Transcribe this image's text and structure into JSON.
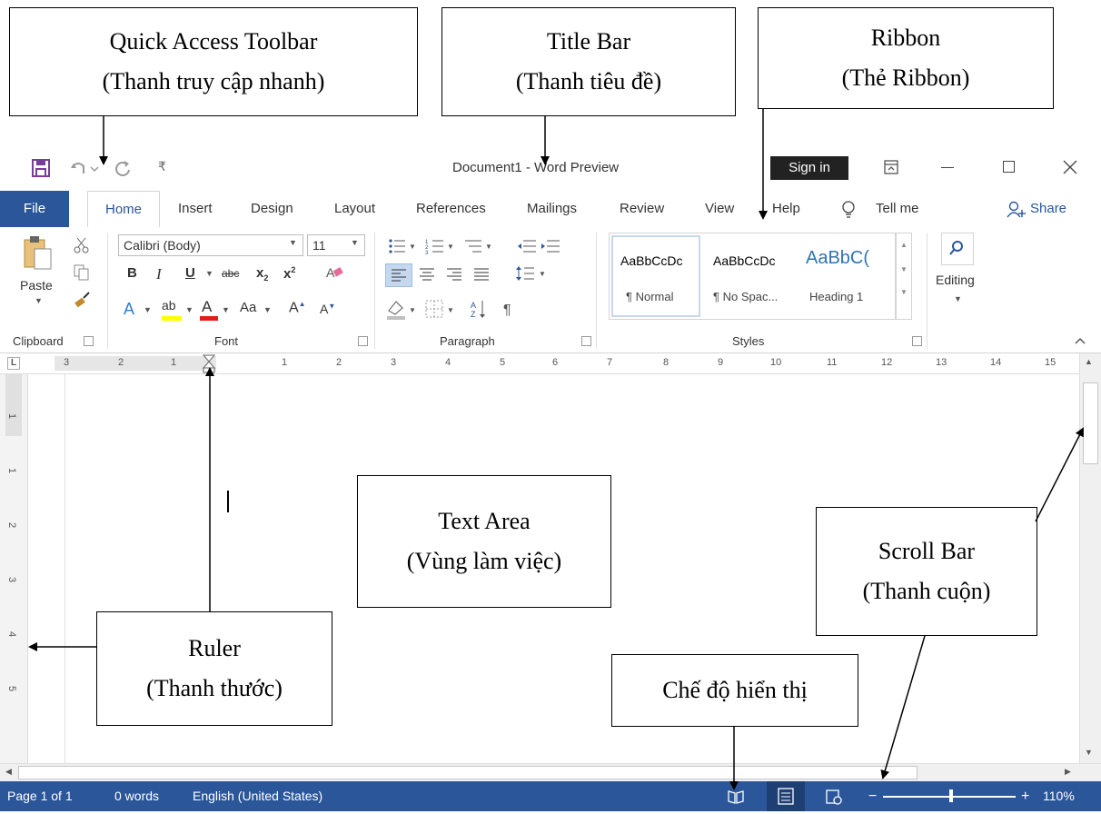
{
  "annotations": {
    "qat": {
      "line1": "Quick Access Toolbar",
      "line2": "(Thanh truy cập nhanh)"
    },
    "title_bar": {
      "line1": "Title Bar",
      "line2": "(Thanh tiêu đề)"
    },
    "ribbon": {
      "line1": "Ribbon",
      "line2": "(Thẻ Ribbon)"
    },
    "text_area": {
      "line1": "Text Area",
      "line2": "(Vùng làm việc)"
    },
    "scroll_bar": {
      "line1": "Scroll Bar",
      "line2": "(Thanh cuộn)"
    },
    "ruler": {
      "line1": "Ruler",
      "line2": "(Thanh thước)"
    },
    "view_modes": {
      "line1": "Chế độ hiển thị"
    }
  },
  "window": {
    "title": "Document1  -  Word Preview",
    "sign_in": "Sign in",
    "tabs": [
      "File",
      "Home",
      "Insert",
      "Design",
      "Layout",
      "References",
      "Mailings",
      "Review",
      "View",
      "Help"
    ],
    "tell_me": "Tell me",
    "share": "Share"
  },
  "ribbon": {
    "paste": "Paste",
    "font_name": "Calibri (Body)",
    "font_size": "11",
    "aa_label": "Aa",
    "styles": [
      {
        "preview": "AaBbCcDc",
        "name": "¶ Normal"
      },
      {
        "preview": "AaBbCcDc",
        "name": "¶ No Spac..."
      },
      {
        "preview": "AaBbC(",
        "name": "Heading 1"
      }
    ],
    "editing": "Editing",
    "groups": [
      "Clipboard",
      "Font",
      "Paragraph",
      "Styles"
    ]
  },
  "ruler": {
    "h_ticks": [
      "3",
      "2",
      "1",
      "1",
      "2",
      "3",
      "4",
      "5",
      "6",
      "7",
      "8",
      "9",
      "10",
      "11",
      "12",
      "13",
      "14",
      "15"
    ],
    "v_ticks": [
      "1",
      "1",
      "2",
      "3",
      "4",
      "5"
    ]
  },
  "status": {
    "page": "Page 1 of 1",
    "words": "0 words",
    "language": "English (United States)",
    "zoom": "110%",
    "zoom_level_percent": 110
  },
  "colors": {
    "accent": "#2b579a",
    "text_area_bg": "#ffffff"
  }
}
